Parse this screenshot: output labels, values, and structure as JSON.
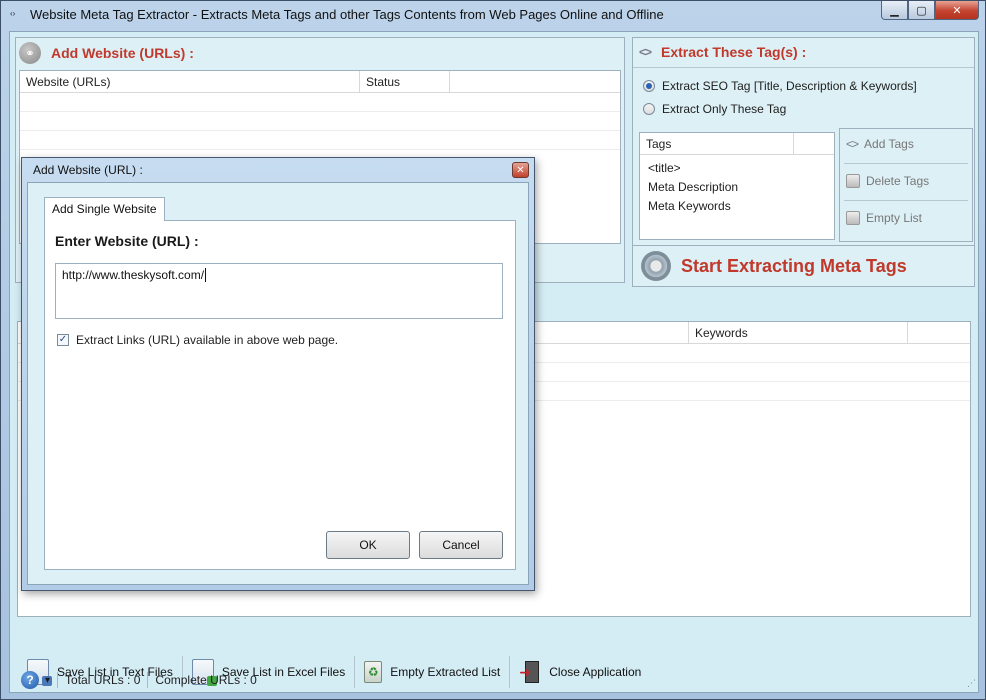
{
  "window": {
    "title": "Website Meta Tag Extractor - Extracts Meta Tags and other Tags Contents from Web Pages Online and Offline",
    "minimize": "▁",
    "maximize": "▢",
    "close": "✕",
    "app_icon": "‹›"
  },
  "add_website_panel": {
    "title": "Add Website (URLs) :",
    "columns": [
      "Website (URLs)",
      "Status"
    ]
  },
  "extract_panel": {
    "title": "Extract These Tag(s) :",
    "option_seo": "Extract SEO Tag [Title, Description & Keywords]",
    "option_only": "Extract Only These Tag",
    "selected_option": "seo",
    "tags_header": "Tags",
    "tags": [
      "<title>",
      "Meta Description",
      "Meta Keywords"
    ],
    "add_tags": "Add Tags",
    "delete_tags": "Delete Tags",
    "empty_list": "Empty List",
    "start_button": "Start Extracting Meta Tags"
  },
  "results_grid": {
    "visible_column": "Keywords"
  },
  "bottom_toolbar": {
    "save_text": "Save List in Text Files",
    "save_excel": "Save List in Excel Files",
    "empty_extracted": "Empty Extracted List",
    "close_app": "Close Application"
  },
  "statusbar": {
    "help": "?",
    "dropdown": "▾",
    "total_urls": "Total URLs :  0",
    "complete_urls": "Complete URLs :  0"
  },
  "dialog": {
    "title": "Add Website (URL) :",
    "close": "✕",
    "tab": "Add Single Website",
    "label": "Enter Website (URL) :",
    "url_value": "http://www.theskysoft.com/",
    "checkbox_label": "Extract Links (URL) available in above web page.",
    "checkbox_checked": true,
    "ok": "OK",
    "cancel": "Cancel"
  },
  "colors": {
    "accent_red": "#c0392b",
    "panel_bg": "#d4ecf4",
    "title_bar": "#bcd3ea"
  }
}
